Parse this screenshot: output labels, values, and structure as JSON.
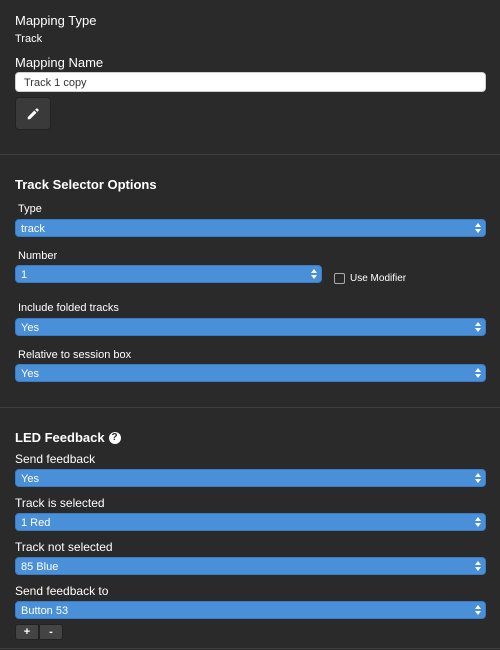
{
  "mapping": {
    "type_label": "Mapping Type",
    "type_value": "Track",
    "name_label": "Mapping Name",
    "name_value": "Track 1 copy",
    "edit_icon": "pencil-icon"
  },
  "track_selector": {
    "heading": "Track Selector Options",
    "type_label": "Type",
    "type_value": "track",
    "number_label": "Number",
    "number_value": "1",
    "use_modifier_label": "Use Modifier",
    "folded_label": "Include folded tracks",
    "folded_value": "Yes",
    "relative_label": "Relative to session box",
    "relative_value": "Yes"
  },
  "led_feedback": {
    "heading": "LED Feedback",
    "help_icon": "question-circle-icon",
    "help_glyph": "?",
    "send_label": "Send feedback",
    "send_value": "Yes",
    "selected_label": "Track is selected",
    "selected_value": "1 Red",
    "not_selected_label": "Track not selected",
    "not_selected_value": "85 Blue",
    "send_to_label": "Send feedback to",
    "send_to_value": "Button 53",
    "add_label": "+",
    "remove_label": "-"
  },
  "colors": {
    "background": "#2a2a2a",
    "select_blue": "#4a90d9"
  }
}
